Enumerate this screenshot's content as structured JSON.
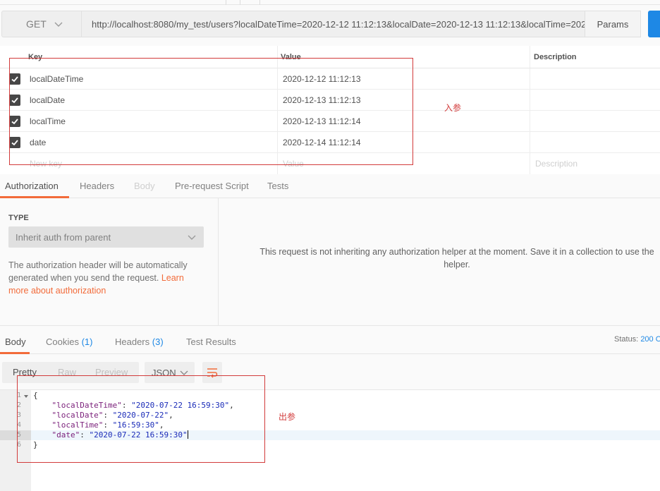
{
  "request": {
    "method": "GET",
    "url": "http://localhost:8080/my_test/users?localDateTime=2020-12-12 11:12:13&localDate=2020-12-13 11:12:13&localTime=2020..",
    "params_label": "Params"
  },
  "params_table": {
    "headers": {
      "key": "Key",
      "value": "Value",
      "description": "Description"
    },
    "rows": [
      {
        "key": "localDateTime",
        "value": "2020-12-12 11:12:13",
        "checked": true
      },
      {
        "key": "localDate",
        "value": "2020-12-13 11:12:13",
        "checked": true
      },
      {
        "key": "localTime",
        "value": "2020-12-13 11:12:14",
        "checked": true
      },
      {
        "key": "date",
        "value": "2020-12-14 11:12:14",
        "checked": true
      }
    ],
    "placeholder": {
      "key": "New key",
      "value": "Value",
      "description": "Description"
    }
  },
  "request_tabs": [
    {
      "label": "Authorization",
      "active": true
    },
    {
      "label": "Headers"
    },
    {
      "label": "Body",
      "disabled": true
    },
    {
      "label": "Pre-request Script"
    },
    {
      "label": "Tests"
    }
  ],
  "auth": {
    "type_label": "TYPE",
    "selected": "Inherit auth from parent",
    "description": "The authorization header will be automatically generated when you send the request. ",
    "learn_link": "Learn more about authorization",
    "message_line1": "This request is not inheriting any authorization helper at the moment. Save it in a collection to use the",
    "message_line2": "helper."
  },
  "response_tabs": {
    "body": "Body",
    "cookies": "Cookies",
    "cookies_count": "(1)",
    "headers": "Headers",
    "headers_count": "(3)",
    "test_results": "Test Results",
    "status_label": "Status:",
    "status_value": "200 O"
  },
  "viewer": {
    "modes": [
      "Pretty",
      "Raw",
      "Preview"
    ],
    "format": "JSON"
  },
  "response_body": {
    "line_numbers": [
      "1",
      "2",
      "3",
      "4",
      "5",
      "6"
    ],
    "open": "{",
    "entries": [
      {
        "key": "\"localDateTime\"",
        "value": "\"2020-07-22 16:59:30\"",
        "sep": ","
      },
      {
        "key": "\"localDate\"",
        "value": "\"2020-07-22\"",
        "sep": ","
      },
      {
        "key": "\"localTime\"",
        "value": "\"16:59:30\"",
        "sep": ","
      },
      {
        "key": "\"date\"",
        "value": "\"2020-07-22 16:59:30\"",
        "sep": ""
      }
    ],
    "close": "}"
  },
  "annotations": {
    "input_label": "入参",
    "output_label": "出参",
    "color": "#d23b3b"
  },
  "colors": {
    "accent": "#f26b3a",
    "link_blue": "#1e88e5"
  }
}
